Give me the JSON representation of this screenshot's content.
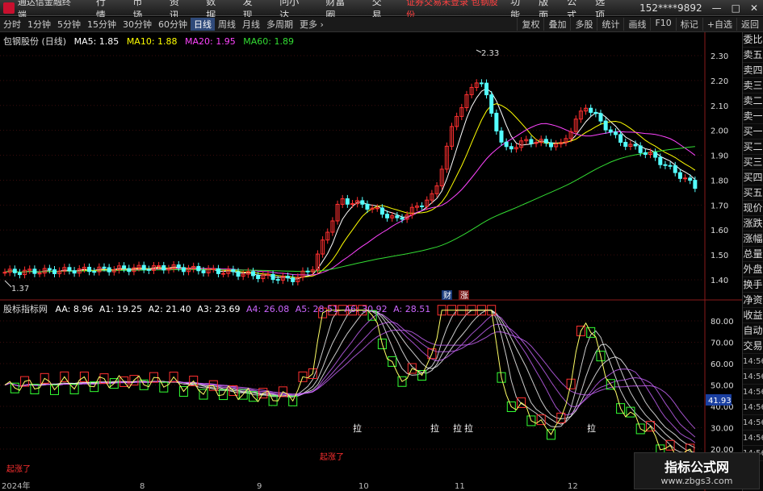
{
  "titlebar": {
    "app_title": "通达信金融终端",
    "menu": [
      "行情",
      "市场",
      "资讯",
      "数据",
      "发现",
      "问小达",
      "财富圈",
      "交易"
    ],
    "alert": "证券交易未登录 包钢股份",
    "right_menu": [
      "功能",
      "版面",
      "公式",
      "选项"
    ],
    "account": "152****9892",
    "window_buttons": [
      "—",
      "□",
      "✕"
    ]
  },
  "periodbar": {
    "periods": [
      "分时",
      "1分钟",
      "5分钟",
      "15分钟",
      "30分钟",
      "60分钟",
      "日线",
      "周线",
      "月线",
      "多周期",
      "更多 ›"
    ],
    "active": "日线",
    "tools": [
      "复权",
      "叠加",
      "多股",
      "统计",
      "画线",
      "F10",
      "标记",
      "+自选",
      "返回"
    ]
  },
  "main": {
    "stock_title": "包钢股份 (日线)",
    "ma": [
      {
        "label": "MA5: 1.85",
        "color": "#ffffff"
      },
      {
        "label": "MA10: 1.88",
        "color": "#ffff00"
      },
      {
        "label": "MA20: 1.95",
        "color": "#ff44ff"
      },
      {
        "label": "MA60: 1.89",
        "color": "#33dd33"
      }
    ],
    "price_ticks": [
      "2.30",
      "2.20",
      "2.10",
      "2.00",
      "1.90",
      "1.80",
      "1.70",
      "1.60",
      "1.50",
      "1.40"
    ],
    "high_label": "2.33",
    "low_label": "1.37",
    "badges": [
      "财",
      "涨"
    ]
  },
  "sub": {
    "title": "股标指标网",
    "params": [
      {
        "label": "AA: 8.96",
        "color": "#ffffff"
      },
      {
        "label": "A1: 19.25",
        "color": "#ffffff"
      },
      {
        "label": "A2: 21.40",
        "color": "#ffffff"
      },
      {
        "label": "A3: 23.69",
        "color": "#ffffff"
      },
      {
        "label": "A4: 26.08",
        "color": "#cc66ff"
      },
      {
        "label": "A5: 28.51",
        "color": "#cc66ff"
      },
      {
        "label": "A6: 30.92",
        "color": "#cc66ff"
      },
      {
        "label": "A: 28.51",
        "color": "#cc66ff"
      }
    ],
    "ticks": [
      "80.00",
      "70.00",
      "60.00",
      "50.00",
      "40.00",
      "30.00",
      "20.00"
    ],
    "current_value": "41.93",
    "annotations": [
      "拉",
      "拉",
      "拉",
      "拉",
      "拉"
    ],
    "signals": [
      "起涨了",
      "起涨了"
    ]
  },
  "xaxis": {
    "labels": [
      "2024年",
      "8",
      "9",
      "10",
      "11",
      "12"
    ]
  },
  "sidebar": {
    "items": [
      "委比",
      "卖五",
      "卖四",
      "卖三",
      "卖二",
      "卖一",
      "买一",
      "买二",
      "买三",
      "买四",
      "买五",
      "现价",
      "涨跌",
      "涨幅",
      "总量",
      "外盘",
      "换手",
      "净资",
      "收益",
      "自动",
      "交易"
    ],
    "times": [
      "14:56",
      "14:56",
      "14:56",
      "14:56",
      "14:56",
      "14:56",
      "14:56"
    ]
  },
  "watermark": {
    "line1": "指标公式网",
    "line2": "www.zbgs3.com"
  }
}
